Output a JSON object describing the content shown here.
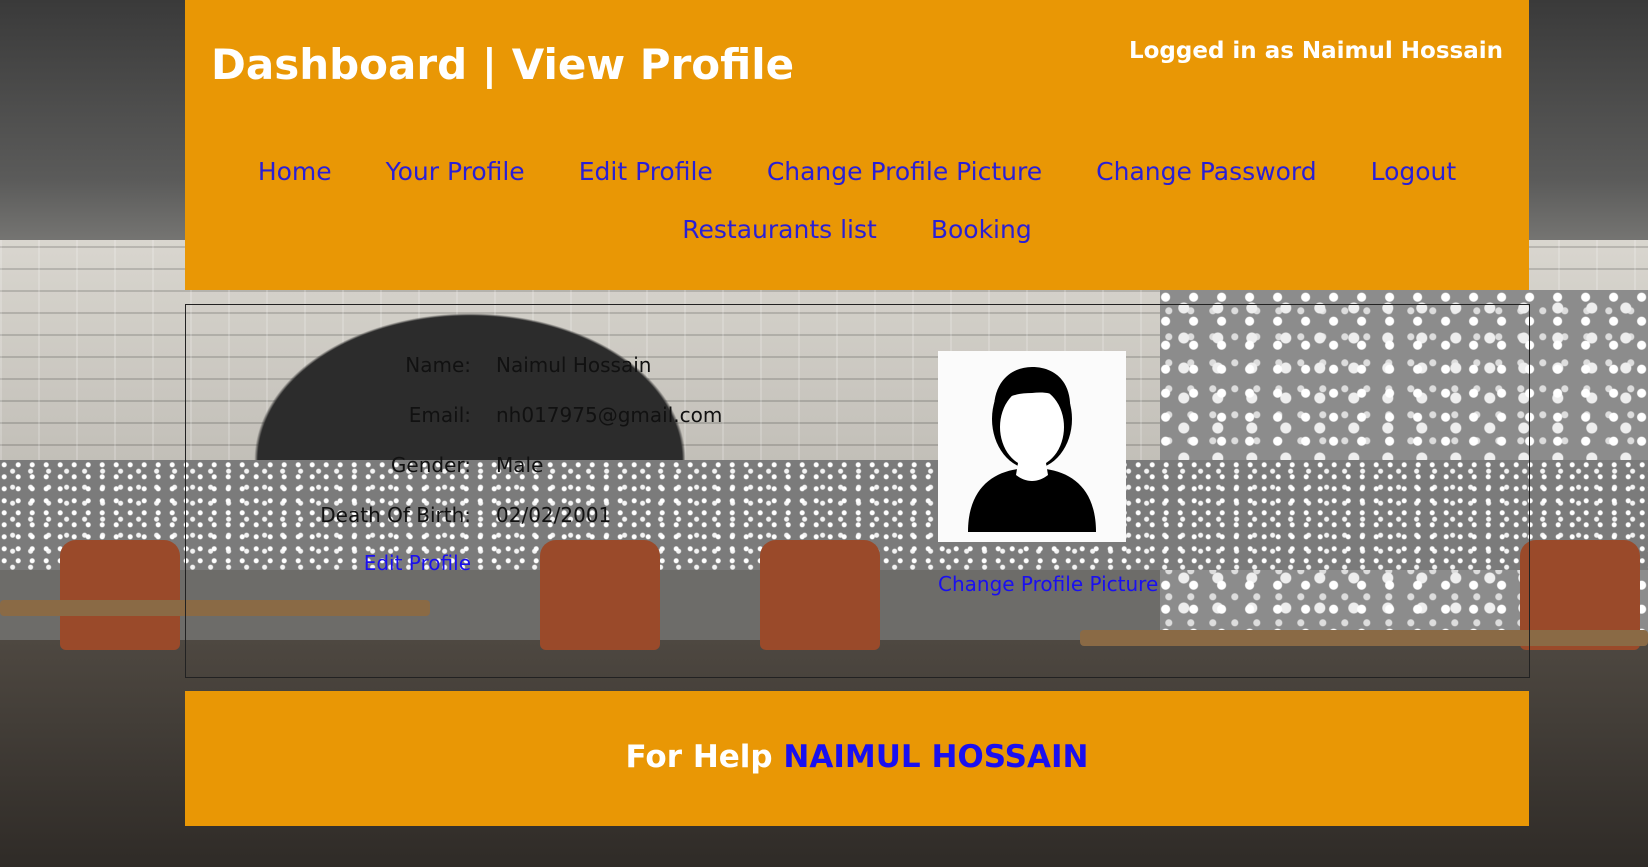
{
  "header": {
    "title": "Dashboard | View Profile",
    "logged_in": "Logged in as Naimul Hossain"
  },
  "nav": {
    "items": [
      {
        "label": "Home"
      },
      {
        "label": "Your Profile"
      },
      {
        "label": "Edit Profile"
      },
      {
        "label": "Change Profile Picture"
      },
      {
        "label": "Change Password"
      },
      {
        "label": "Logout"
      },
      {
        "label": "Restaurants list"
      },
      {
        "label": "Booking"
      }
    ]
  },
  "profile": {
    "fields": [
      {
        "label": "Name:",
        "value": "Naimul Hossain"
      },
      {
        "label": "Email:",
        "value": "nh017975@gmail.com"
      },
      {
        "label": "Gender:",
        "value": "Male"
      },
      {
        "label": "Death Of Birth:",
        "value": "02/02/2001"
      }
    ],
    "edit_link": "Edit Profile",
    "avatar_icon": "user-silhouette-icon",
    "change_picture_link": "Change Profile Picture"
  },
  "footer": {
    "prefix": "For Help",
    "name": "NAIMUL HOSSAIN"
  },
  "colors": {
    "header_bg": "#e99705",
    "link": "#2a1fd6",
    "text_light": "#ffffff"
  }
}
